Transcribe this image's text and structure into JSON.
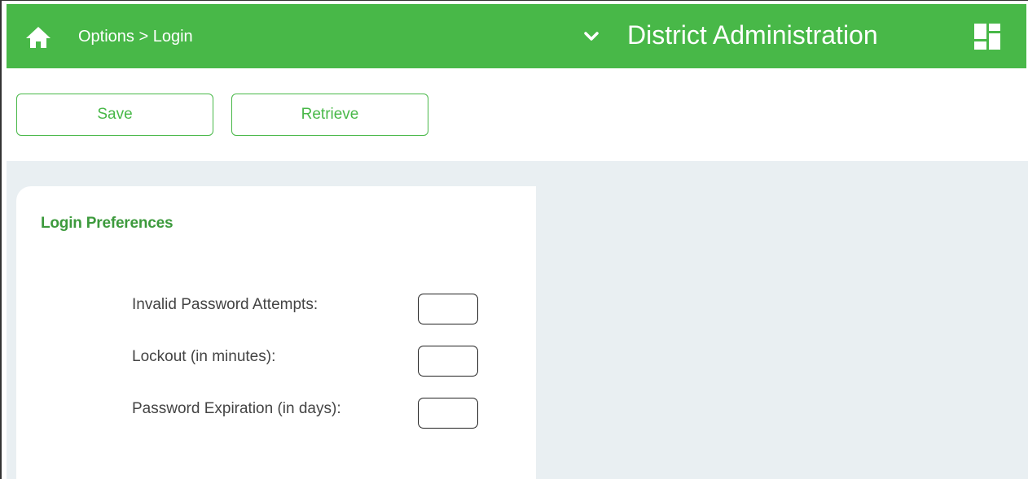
{
  "header": {
    "breadcrumb": "Options > Login",
    "app_title": "District Administration",
    "icons": {
      "home": "home-icon",
      "dropdown": "chevron-down-icon",
      "apps": "grid-icon"
    },
    "colors": {
      "bar": "#48b848",
      "text": "#ffffff"
    }
  },
  "toolbar": {
    "save_label": "Save",
    "retrieve_label": "Retrieve"
  },
  "panel": {
    "title": "Login Preferences",
    "fields": [
      {
        "label": "Invalid Password Attempts:",
        "value": ""
      },
      {
        "label": "Lockout (in minutes):",
        "value": ""
      },
      {
        "label": "Password Expiration (in days):",
        "value": ""
      }
    ]
  },
  "colors": {
    "accent": "#48b848",
    "content_bg": "#e9eff2"
  }
}
